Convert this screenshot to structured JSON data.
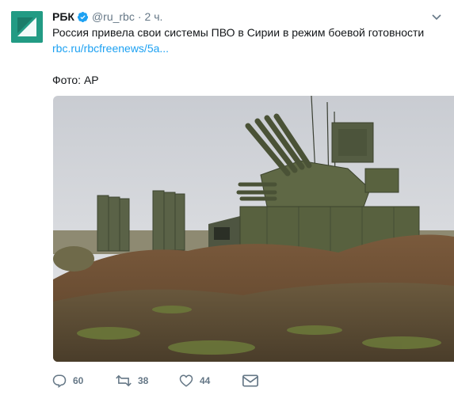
{
  "account": {
    "name": "РБК",
    "handle": "@ru_rbc",
    "separator": "·",
    "time": "2 ч.",
    "avatar_icon": "rbc-logo-icon",
    "brand_color": "#229b84"
  },
  "tweet": {
    "text": "Россия привела свои системы ПВО в Сирии в режим боевой готовности",
    "link": "rbc.ru/rbcfreenews/5a...",
    "photo_credit": "Фото: AP"
  },
  "media": {
    "icon": "photo-air-defense-systems"
  },
  "actions": {
    "reply": {
      "icon": "reply-icon",
      "count": "60"
    },
    "retweet": {
      "icon": "retweet-icon",
      "count": "38"
    },
    "like": {
      "icon": "heart-icon",
      "count": "44"
    },
    "dm": {
      "icon": "envelope-icon"
    }
  },
  "colors": {
    "text": "#14171a",
    "secondary": "#657786",
    "link": "#1da1f2",
    "verified": "#1da1f2"
  }
}
